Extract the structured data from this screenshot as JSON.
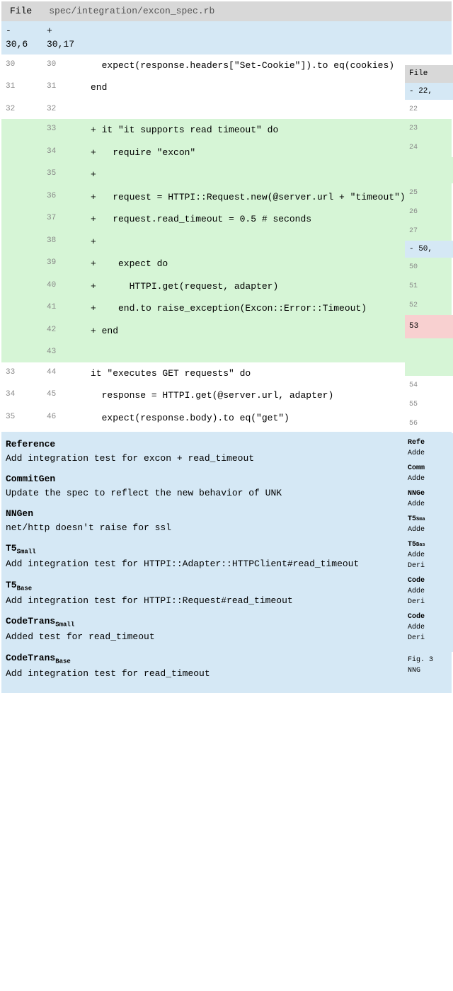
{
  "left": {
    "file_label": "File",
    "file_path": "spec/integration/excon_spec.rb",
    "hunk_old": "- 30,6",
    "hunk_new": "+\n30,17",
    "rows": [
      {
        "old": "30",
        "new": "30",
        "type": "context",
        "code": "  expect(response.headers[\"Set-Cookie\"]).to eq(cookies)"
      },
      {
        "old": "31",
        "new": "31",
        "type": "context",
        "code": "end"
      },
      {
        "old": "32",
        "new": "32",
        "type": "context",
        "code": ""
      },
      {
        "old": "",
        "new": "33",
        "type": "added",
        "code": "+ it \"it supports read timeout\" do"
      },
      {
        "old": "",
        "new": "34",
        "type": "added",
        "code": "+   require \"excon\""
      },
      {
        "old": "",
        "new": "35",
        "type": "added",
        "code": "+"
      },
      {
        "old": "",
        "new": "36",
        "type": "added",
        "code": "+   request = HTTPI::Request.new(@server.url + \"timeout\")"
      },
      {
        "old": "",
        "new": "37",
        "type": "added",
        "code": "+   request.read_timeout = 0.5 # seconds"
      },
      {
        "old": "",
        "new": "38",
        "type": "added",
        "code": "+"
      },
      {
        "old": "",
        "new": "39",
        "type": "added",
        "code": "+    expect do"
      },
      {
        "old": "",
        "new": "40",
        "type": "added",
        "code": "+      HTTPI.get(request, adapter)"
      },
      {
        "old": "",
        "new": "41",
        "type": "added",
        "code": "+    end.to raise_exception(Excon::Error::Timeout)"
      },
      {
        "old": "",
        "new": "42",
        "type": "added",
        "code": "+ end"
      },
      {
        "old": "",
        "new": "43",
        "type": "added",
        "code": ""
      },
      {
        "old": "33",
        "new": "44",
        "type": "context",
        "code": "it \"executes GET requests\" do"
      },
      {
        "old": "34",
        "new": "45",
        "type": "context",
        "code": "  response = HTTPI.get(@server.url, adapter)"
      },
      {
        "old": "35",
        "new": "46",
        "type": "context",
        "code": "  expect(response.body).to eq(\"get\")"
      }
    ],
    "summary": [
      {
        "title": "Reference",
        "text": "Add integration test for excon + read_timeout"
      },
      {
        "title": "CommitGen",
        "text": "Update the spec to reflect the new behavior of UNK"
      },
      {
        "title": "NNGen",
        "text": "net/http doesn't raise for ssl"
      },
      {
        "title": "T5",
        "sub": "Small",
        "text": "Add integration test for HTTPI::Adapter::HTTPClient#read_timeout"
      },
      {
        "title": "T5",
        "sub": "Base",
        "text": "Add integration test for HTTPI::Request#read_timeout"
      },
      {
        "title": "CodeTrans",
        "sub": "Small",
        "text": "Added test for read_timeout"
      },
      {
        "title": "CodeTrans",
        "sub": "Base",
        "text": "Add integration test for read_timeout"
      }
    ]
  },
  "right": {
    "file_label": "File",
    "hunk1": "- 22,",
    "lns1": [
      "22",
      "23",
      "24"
    ],
    "lns2": [
      "25",
      "26",
      "27"
    ],
    "hunk2": "- 50,",
    "lns3": [
      "50",
      "51",
      "52"
    ],
    "ln_removed": "53",
    "lns4": [
      "54",
      "55",
      "56"
    ],
    "summaries": [
      {
        "t": "Refe",
        "x": "Adde"
      },
      {
        "t": "Comm",
        "x": "Adde"
      },
      {
        "t": "NNGe",
        "x": "Adde"
      },
      {
        "t": "T5",
        "s": "Sma",
        "x": "Adde"
      },
      {
        "t": "T5",
        "s": "Bas",
        "x": "Adde\nDeri"
      },
      {
        "t": "Code",
        "x": "Adde\nDeri"
      },
      {
        "t": "Code",
        "x": "Adde\nDeri"
      }
    ],
    "caption": "Fig. 3\nNNG"
  }
}
